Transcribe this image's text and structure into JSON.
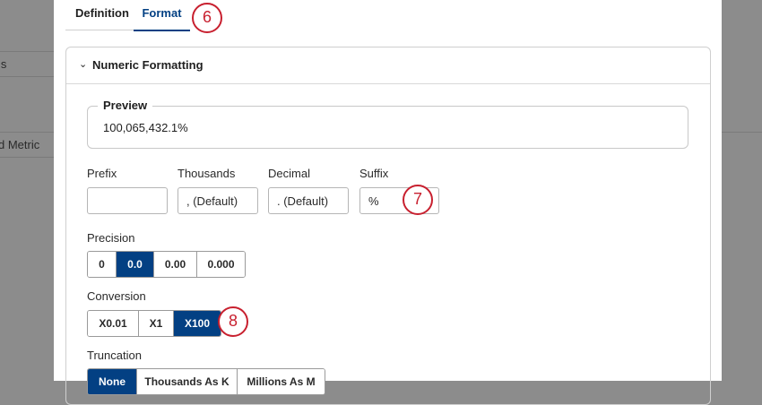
{
  "background": {
    "left_items": [
      "ls",
      "d Metric"
    ]
  },
  "tabs": [
    {
      "label": "Definition",
      "active": false
    },
    {
      "label": "Format",
      "active": true
    }
  ],
  "annotations": [
    "6",
    "7",
    "8"
  ],
  "section": {
    "title": "Numeric Formatting"
  },
  "preview": {
    "label": "Preview",
    "value": "100,065,432.1%"
  },
  "fields": [
    {
      "label": "Prefix",
      "value": ""
    },
    {
      "label": "Thousands",
      "value": ", (Default)"
    },
    {
      "label": "Decimal",
      "value": ". (Default)"
    },
    {
      "label": "Suffix",
      "value": "%"
    }
  ],
  "precision": {
    "label": "Precision",
    "options": [
      "0",
      "0.0",
      "0.00",
      "0.000"
    ],
    "selected": "0.0"
  },
  "conversion": {
    "label": "Conversion",
    "options": [
      "X0.01",
      "X1",
      "X100"
    ],
    "selected": "X100"
  },
  "truncation": {
    "label": "Truncation",
    "options": [
      "None",
      "Thousands As K",
      "Millions As M"
    ],
    "selected": "None"
  },
  "colors": {
    "accent": "#034083",
    "annotation": "#c8202f"
  }
}
